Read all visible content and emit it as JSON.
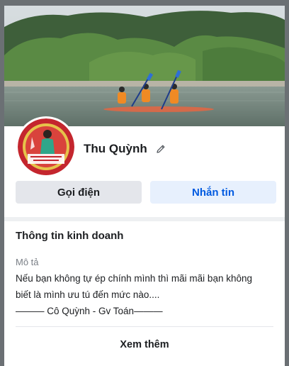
{
  "profile": {
    "name": "Thu Quỳnh",
    "cover_description_icon": "cover-photo",
    "avatar_icon": "avatar-photo"
  },
  "actions": {
    "call_label": "Gọi điện",
    "message_label": "Nhắn tin"
  },
  "business_info": {
    "title": "Thông tin kinh doanh",
    "description_label": "Mô tả",
    "description_lines": [
      "Nếu bạn không tự ép chính mình thì mãi mãi bạn không",
      "biết là mình ưu tú đến mức nào....",
      "——— Cô Quỳnh - Gv Toán———"
    ],
    "see_more_label": "Xem thêm"
  },
  "colors": {
    "message_button_bg": "#e7f0fd",
    "message_button_text": "#005ae0",
    "call_button_bg": "#e4e6eb"
  }
}
